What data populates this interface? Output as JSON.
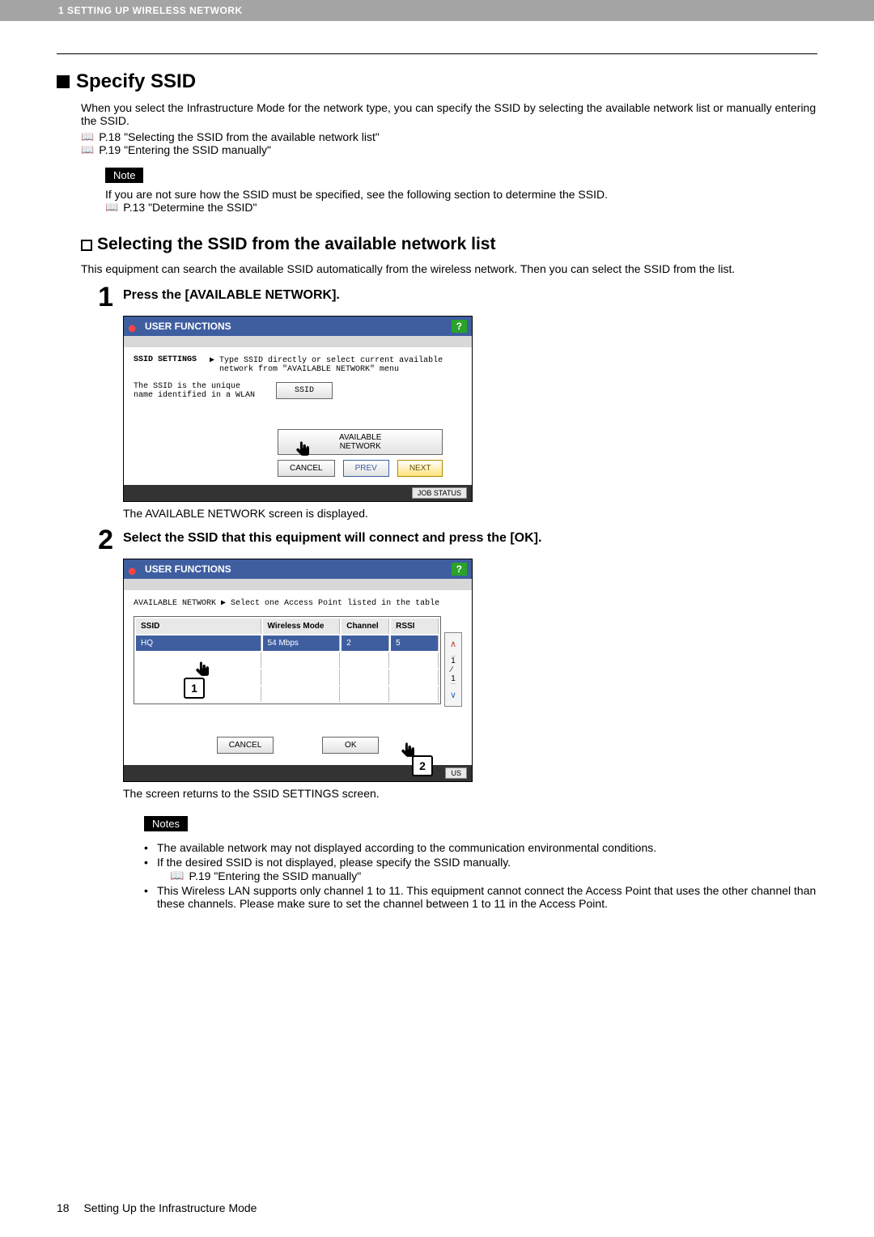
{
  "topbar": "1 SETTING UP WIRELESS NETWORK",
  "section": {
    "title": "Specify SSID",
    "intro": "When you select the Infrastructure Mode for the network type, you can specify the SSID by selecting the available network list or manually entering the SSID.",
    "ref1": "P.18 \"Selecting the SSID from the available network list\"",
    "ref2": "P.19 \"Entering the SSID manually\"",
    "note_label": "Note",
    "note_text": "If you are not sure how the SSID must be specified, see the following section to determine the SSID.",
    "note_ref": "P.13 \"Determine the SSID\""
  },
  "subsection": {
    "title": "Selecting the SSID from the available network list",
    "intro": "This equipment can search the available SSID automatically from the wireless network.  Then you can select the SSID from the list."
  },
  "step1": {
    "title": "Press the [AVAILABLE NETWORK].",
    "header_title": "USER FUNCTIONS",
    "help": "?",
    "panel_title": "SSID SETTINGS",
    "panel_desc": "▶ Type SSID directly or select current available\n  network from \"AVAILABLE NETWORK\" menu",
    "panel_note": "The SSID is the unique name identified in a WLAN",
    "btn_ssid": "SSID",
    "btn_available": "AVAILABLE\nNETWORK",
    "btn_cancel": "CANCEL",
    "btn_prev": "PREV",
    "btn_next": "NEXT",
    "job_status": "JOB STATUS",
    "caption": "The AVAILABLE NETWORK screen is displayed."
  },
  "step2": {
    "title": "Select the SSID that this equipment will connect and press the [OK].",
    "header_title": "USER FUNCTIONS",
    "help": "?",
    "panel_title": "AVAILABLE NETWORK  ▶ Select one Access Point listed in the table",
    "cols": {
      "ssid": "SSID",
      "mode": "Wireless Mode",
      "channel": "Channel",
      "rssi": "RSSI"
    },
    "row": {
      "ssid": "HQ",
      "mode": "54 Mbps",
      "channel": "2",
      "rssi": "5"
    },
    "scroll": {
      "up": "∧",
      "mid": "1\n∕\n1",
      "down": "∨"
    },
    "btn_cancel": "CANCEL",
    "btn_ok": "OK",
    "job_status_tail": "US",
    "caption": "The screen returns to the SSID SETTINGS screen.",
    "callout1": "1",
    "callout2": "2"
  },
  "notes2": {
    "label": "Notes",
    "li1": "The available network may not displayed according to the communication environmental conditions.",
    "li2": "If the desired SSID is not displayed, please specify the SSID manually.",
    "li2_ref": "P.19 \"Entering the SSID manually\"",
    "li3": "This Wireless LAN supports only channel 1 to 11.  This equipment cannot connect the Access Point that uses the other channel than these channels.   Please make sure to set the channel between 1 to 11 in the Access Point."
  },
  "footer": {
    "page": "18",
    "text": "Setting Up the Infrastructure Mode"
  }
}
